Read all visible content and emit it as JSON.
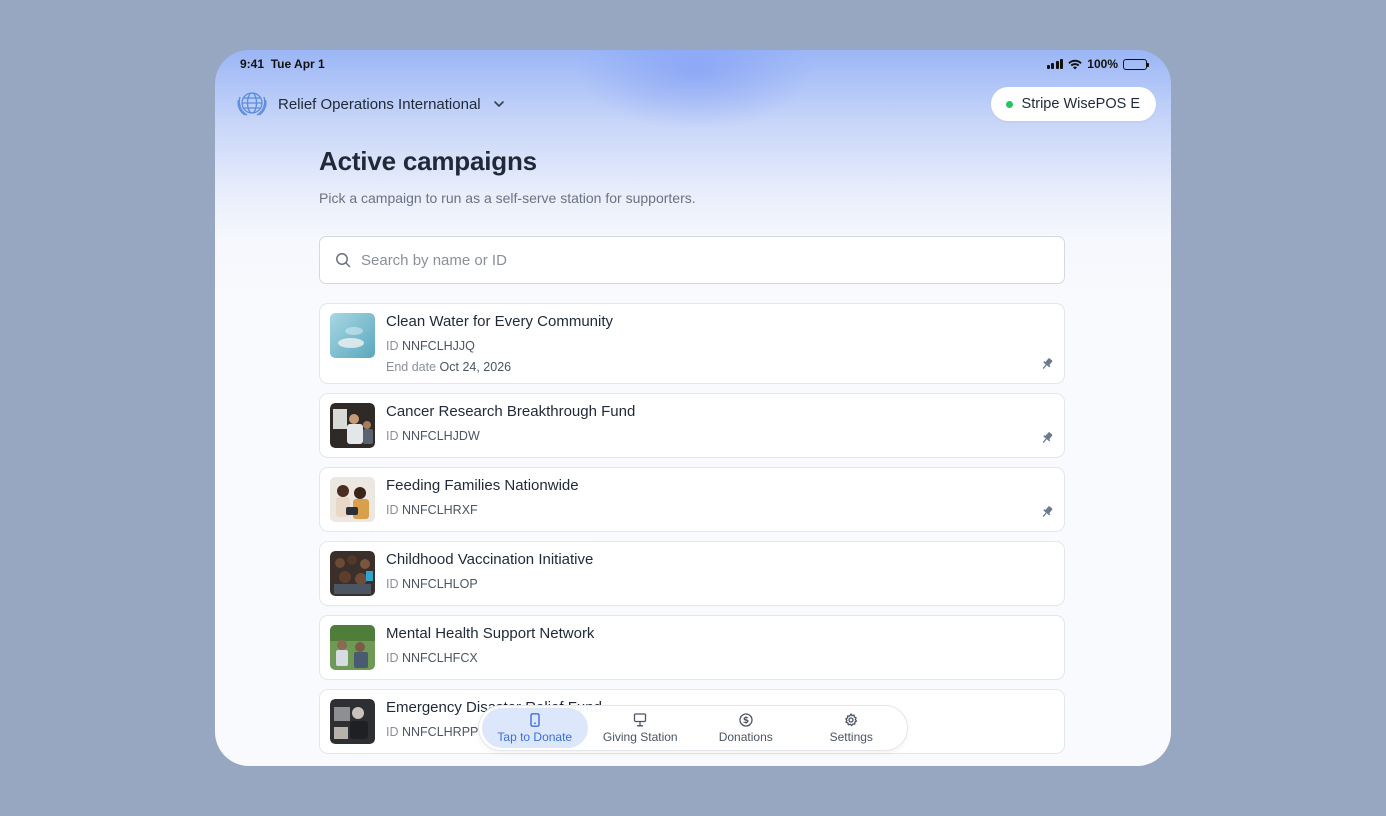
{
  "status_bar": {
    "time": "9:41",
    "date": "Tue Apr 1",
    "battery": "100%"
  },
  "header": {
    "org_name": "Relief Operations International",
    "terminal_name": "Stripe WisePOS E",
    "terminal_status_color": "#22c55e"
  },
  "page": {
    "title": "Active campaigns",
    "subtitle": "Pick a campaign to run as a self-serve station for supporters."
  },
  "search": {
    "placeholder": "Search by name or ID",
    "value": ""
  },
  "labels": {
    "id": "ID",
    "end_date": "End date"
  },
  "campaigns": [
    {
      "title": "Clean Water for Every Community",
      "id": "NNFCLHJJQ",
      "end_date": "Oct 24, 2026",
      "pinned": true
    },
    {
      "title": "Cancer Research Breakthrough Fund",
      "id": "NNFCLHJDW",
      "pinned": true
    },
    {
      "title": "Feeding Families Nationwide",
      "id": "NNFCLHRXF",
      "pinned": true
    },
    {
      "title": "Childhood Vaccination Initiative",
      "id": "NNFCLHLOP",
      "pinned": false
    },
    {
      "title": "Mental Health Support Network",
      "id": "NNFCLHFCX",
      "pinned": false
    },
    {
      "title": "Emergency Disaster Relief Fund",
      "id": "NNFCLHRPP",
      "pinned": false
    }
  ],
  "tabs": [
    {
      "label": "Tap to Donate",
      "icon": "tablet-icon",
      "active": true
    },
    {
      "label": "Giving Station",
      "icon": "kiosk-icon",
      "active": false
    },
    {
      "label": "Donations",
      "icon": "dollar-circle-icon",
      "active": false
    },
    {
      "label": "Settings",
      "icon": "gear-icon",
      "active": false
    }
  ],
  "colors": {
    "accent": "#3b6fd9",
    "active_tab_bg": "#dde7fb",
    "background": "#97a7c1"
  }
}
